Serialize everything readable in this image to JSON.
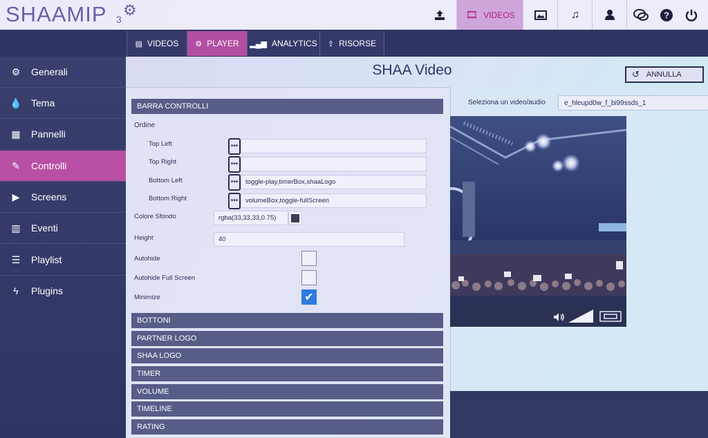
{
  "brand": {
    "name": "SHAAMIP",
    "version": "3"
  },
  "topnav": {
    "upload_icon": "upload-icon",
    "videos_label": "VIDEOS",
    "image_icon": "image-icon",
    "music_icon": "music-icon",
    "user_icon": "user-icon",
    "chat_icon": "chat-icon",
    "help_icon": "help-icon",
    "power_icon": "power-icon"
  },
  "tabs": [
    {
      "label": "VIDEOS",
      "icon": "film-icon"
    },
    {
      "label": "PLAYER",
      "icon": "gears-icon"
    },
    {
      "label": "ANALYTICS",
      "icon": "signal-icon"
    },
    {
      "label": "RISORSE",
      "icon": "upload-icon"
    }
  ],
  "sidebar": {
    "items": [
      {
        "label": "Generali",
        "icon": "cogs-icon"
      },
      {
        "label": "Tema",
        "icon": "drop-icon"
      },
      {
        "label": "Pannelli",
        "icon": "grid-icon"
      },
      {
        "label": "Controlli",
        "icon": "pencil-icon"
      },
      {
        "label": "Screens",
        "icon": "play-square-icon"
      },
      {
        "label": "Eventi",
        "icon": "bar-chart-icon"
      },
      {
        "label": "Playlist",
        "icon": "list-icon"
      },
      {
        "label": "Plugins",
        "icon": "bolt-icon"
      }
    ]
  },
  "header": {
    "title": "SHAA Video",
    "cancel_label": "ANNULLA"
  },
  "controls": {
    "section_title": "BARRA CONTROLLI",
    "order_label": "Ordine",
    "order": [
      {
        "label": "Top Left",
        "value": ""
      },
      {
        "label": "Top Right",
        "value": ""
      },
      {
        "label": "Bottom Left",
        "value": "toggle-play,timerBox,shaaLogo"
      },
      {
        "label": "Bottom Right",
        "value": "volumeBox,toggle-fullScreen"
      }
    ],
    "background_label": "Colore Sfondo",
    "background_value": "rgba(33,33,33,0.75)",
    "height_label": "Height",
    "height_value": "40",
    "autohide_label": "Autohide",
    "autohide_checked": false,
    "autohide_full_label": "Autohide Full Screen",
    "autohide_full_checked": false,
    "minimize_label": "Minimize",
    "minimize_checked": true
  },
  "sections": [
    "BOTTONI",
    "PARTNER LOGO",
    "SHAA LOGO",
    "TIMER",
    "VOLUME",
    "TIMELINE",
    "RATING"
  ],
  "preview": {
    "select_label": "Seleziona un video/audio",
    "select_value": "e_hleupd0w_f_bi99ssds_1"
  }
}
